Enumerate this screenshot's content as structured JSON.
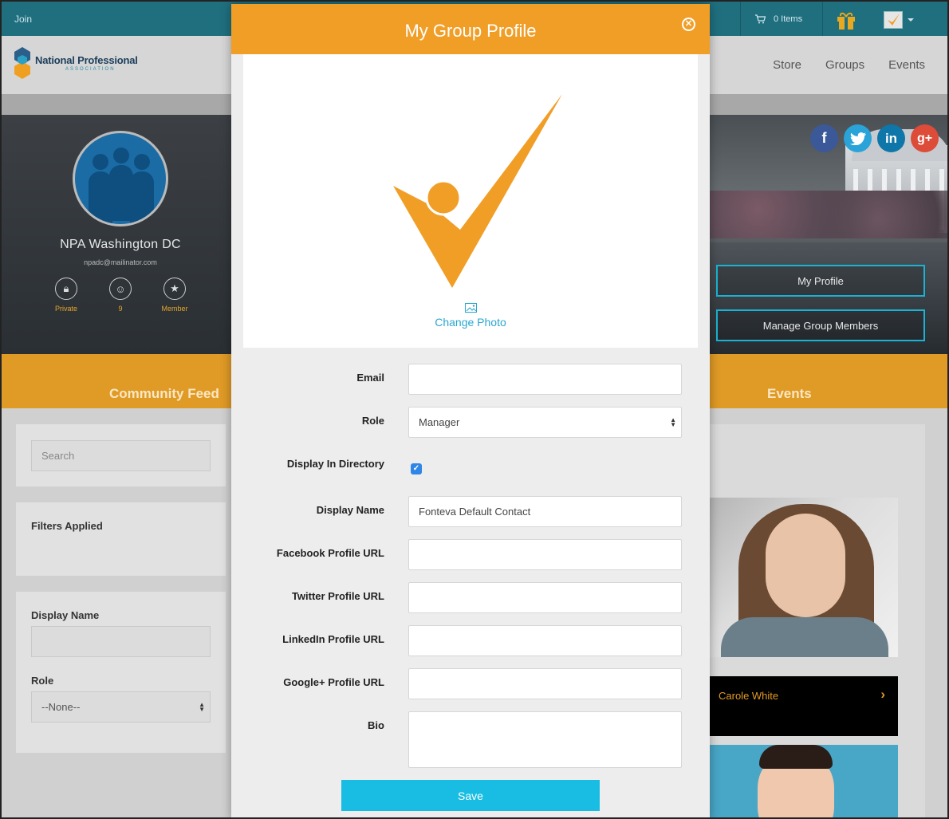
{
  "topbar": {
    "join_label": "Join",
    "cart_label": "0 Items"
  },
  "brand": {
    "name": "National Professional",
    "tagline": "ASSOCIATION"
  },
  "nav": {
    "items": [
      "Store",
      "Groups",
      "Events"
    ]
  },
  "group": {
    "name": "NPA Washington DC",
    "email": "npadc@mailinator.com",
    "stats": [
      {
        "icon": "lock-icon",
        "label": "Private"
      },
      {
        "icon": "user-icon",
        "label": "9"
      },
      {
        "icon": "star-icon",
        "label": "Member"
      }
    ]
  },
  "social": [
    "facebook-icon",
    "twitter-icon",
    "linkedin-icon",
    "google-plus-icon"
  ],
  "hero_buttons": {
    "my_profile": "My Profile",
    "manage_members": "Manage Group Members"
  },
  "tabs": {
    "community_feed": "Community Feed",
    "events": "Events"
  },
  "sidebar": {
    "search_placeholder": "Search",
    "filters_title": "Filters Applied",
    "display_name_label": "Display Name",
    "role_label": "Role",
    "role_value": "--None--"
  },
  "members": {
    "featured_name": "Carole White"
  },
  "modal": {
    "title": "My Group Profile",
    "change_photo": "Change Photo",
    "fields": {
      "email": {
        "label": "Email",
        "value": ""
      },
      "role": {
        "label": "Role",
        "value": "Manager"
      },
      "display_in_directory": {
        "label": "Display In Directory",
        "checked": true
      },
      "display_name": {
        "label": "Display Name",
        "value": "Fonteva Default Contact"
      },
      "facebook": {
        "label": "Facebook Profile URL",
        "value": ""
      },
      "twitter": {
        "label": "Twitter Profile URL",
        "value": ""
      },
      "linkedin": {
        "label": "LinkedIn Profile URL",
        "value": ""
      },
      "googleplus": {
        "label": "Google+ Profile URL",
        "value": ""
      },
      "bio": {
        "label": "Bio",
        "value": ""
      }
    },
    "save_label": "Save"
  },
  "colors": {
    "accent_orange": "#f19e27",
    "topbar_teal": "#1f6f7f",
    "button_blue": "#19bde3",
    "link_blue": "#2aa7cf"
  }
}
